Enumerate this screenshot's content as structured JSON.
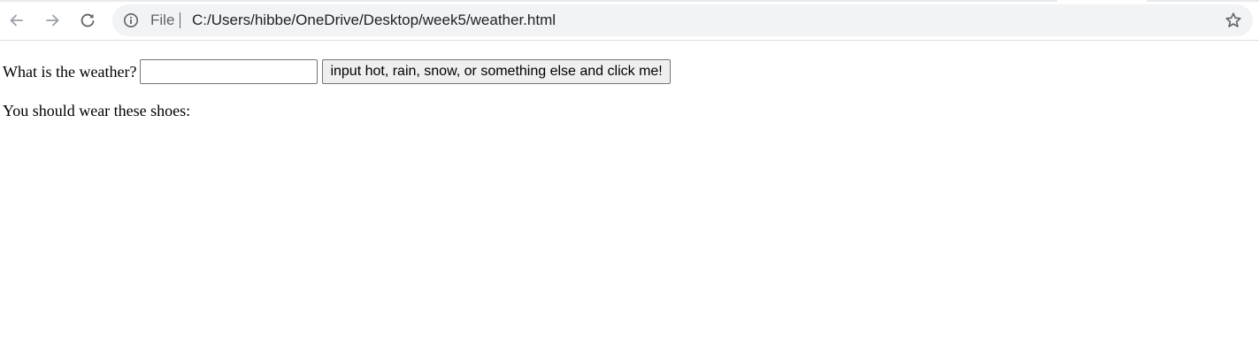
{
  "browser": {
    "nav": {
      "back_icon": "arrow-left-icon",
      "forward_icon": "arrow-right-icon",
      "reload_icon": "reload-icon"
    },
    "omnibox": {
      "info_icon": "info-circle-icon",
      "scheme_label": "File",
      "url": "C:/Users/hibbe/OneDrive/Desktop/week5/weather.html",
      "bookmark_icon": "star-outline-icon"
    }
  },
  "page": {
    "question_label": "What is the weather?",
    "weather_input_value": "",
    "submit_button_label": "input hot, rain, snow, or something else and click me!",
    "result_text": "You should wear these shoes:"
  }
}
